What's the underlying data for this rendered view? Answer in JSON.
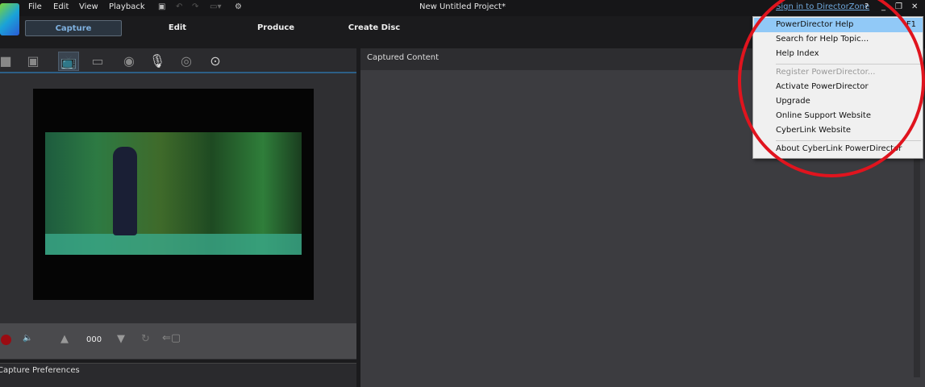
{
  "window": {
    "title": "New Untitled Project*",
    "signin": "Sign in to DirectorZone",
    "help": "?",
    "minimize": "_",
    "restore": "❐",
    "close": "✕"
  },
  "menubar": [
    "File",
    "Edit",
    "View",
    "Playback"
  ],
  "modes": [
    "Capture",
    "Edit",
    "Produce",
    "Create Disc"
  ],
  "capture": {
    "counter": "000",
    "prefs_title": "Capture Preferences"
  },
  "right": {
    "title": "Captured Content"
  },
  "help_menu": {
    "items": [
      {
        "label": "PowerDirector Help",
        "shortcut": "F1",
        "highlighted": true
      },
      {
        "label": "Search for Help Topic..."
      },
      {
        "label": "Help Index"
      },
      {
        "label": "Register PowerDirector...",
        "disabled": true
      },
      {
        "label": "Activate PowerDirector"
      },
      {
        "label": "Upgrade"
      },
      {
        "label": "Online Support Website"
      },
      {
        "label": "CyberLink Website"
      },
      {
        "label": "About CyberLink PowerDirector"
      }
    ]
  },
  "colors": {
    "accent": "#7fb1e0",
    "annotation": "#e0141e",
    "highlight": "#91c9f7"
  }
}
